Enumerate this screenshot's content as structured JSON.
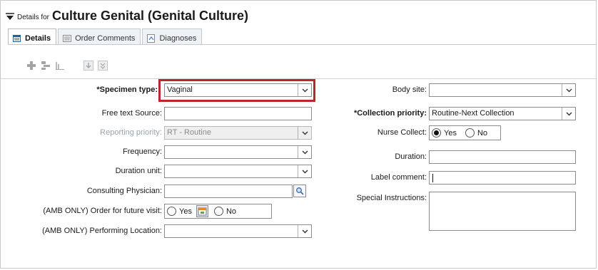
{
  "header": {
    "prefix": "Details for",
    "title": "Culture Genital (Genital Culture)"
  },
  "tabs": [
    {
      "label": "Details",
      "active": true
    },
    {
      "label": "Order Comments",
      "active": false
    },
    {
      "label": "Diagnoses",
      "active": false
    }
  ],
  "form": {
    "specimen_type": {
      "label": "*Specimen type:",
      "value": "Vaginal"
    },
    "free_text_source": {
      "label": "Free text Source:",
      "value": ""
    },
    "reporting_priority": {
      "label": "Reporting priority:",
      "value": "RT - Routine"
    },
    "frequency": {
      "label": "Frequency:",
      "value": ""
    },
    "duration_unit": {
      "label": "Duration unit:",
      "value": ""
    },
    "consulting_physician": {
      "label": "Consulting Physician:",
      "value": ""
    },
    "future_visit": {
      "label": "(AMB ONLY) Order for future visit:",
      "yes": "Yes",
      "no": "No"
    },
    "performing_location": {
      "label": "(AMB ONLY) Performing Location:",
      "value": ""
    },
    "body_site": {
      "label": "Body site:",
      "value": ""
    },
    "collection_priority": {
      "label": "*Collection priority:",
      "value": "Routine-Next Collection"
    },
    "nurse_collect": {
      "label": "Nurse Collect:",
      "yes": "Yes",
      "no": "No",
      "selected": "Yes"
    },
    "duration": {
      "label": "Duration:",
      "value": ""
    },
    "label_comment": {
      "label": "Label comment:",
      "value": ""
    },
    "special_instructions": {
      "label": "Special Instructions:",
      "value": ""
    }
  },
  "colors": {
    "highlight": "#b9272c",
    "tab_bg": "#eef2f6",
    "disabled_text": "#9aa3ad"
  }
}
